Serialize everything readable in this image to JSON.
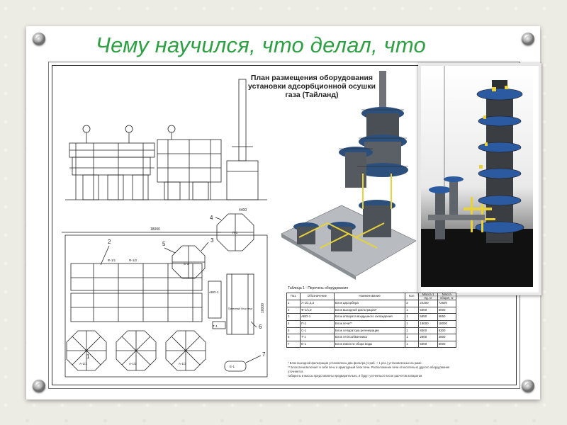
{
  "slide": {
    "title": "Чему научился, что делал, что"
  },
  "drawing": {
    "plan_title": "План размещения оборудования установки адсорбционной осушки газа (Тайланд)",
    "dim_top": "4400",
    "dim_left": "18000",
    "dim_right": "10000",
    "callouts": [
      "1",
      "2",
      "3",
      "4",
      "5",
      "6",
      "7"
    ],
    "equipment_labels": {
      "p1": "П-1",
      "avo": "АВО-1",
      "t1": "Т-1",
      "e1": "Е-1",
      "burner": "Приемный блок печи",
      "a1": "А-1/1",
      "a2": "А-1/2",
      "a3": "А-1/3",
      "f1": "Ф-1/1",
      "f2": "Ф-1/2",
      "c1": "С-1"
    }
  },
  "table": {
    "caption": "Таблица 1 - Перечень оборудования",
    "headers": [
      "Поз.",
      "Обозначение",
      "Наименование",
      "Кол.",
      "Масса 1 ед. кг",
      "Масса общая, кг"
    ],
    "rows": [
      [
        "1",
        "А-1/1,2,3",
        "Блок адсорбера",
        "3",
        "24200",
        "72600"
      ],
      [
        "2",
        "Ф-1/1,2",
        "Блок выходной фильтрации*",
        "1",
        "5000",
        "5000"
      ],
      [
        "3",
        "АВО-1",
        "Блок аппарата воздушного охлаждения",
        "1",
        "5850",
        "5850"
      ],
      [
        "4",
        "П-1",
        "Блок печи**",
        "1",
        "18000",
        "18000"
      ],
      [
        "5",
        "С-1",
        "Блок сепаратора регенерации",
        "1",
        "8300",
        "8300"
      ],
      [
        "6",
        "Т-1",
        "Блок теплообменника",
        "1",
        "2800",
        "2800"
      ],
      [
        "7",
        "Е-1",
        "Блок емкости сбора воды",
        "1",
        "5000",
        "5000"
      ]
    ],
    "notes": [
      "* Блок выходной фильтрации установлены два фильтра (1 раб. + 1 рез.) установленных на раме.",
      "** Блок печи включает в себя печь и арматурный блок печи. Расположение печи относительно другого оборудования уточняется.",
      "Габариты и массы представлены предварительно, и будут уточняться после расчетов аппаратов"
    ]
  },
  "colors": {
    "title_green": "#2ea043",
    "steel_blue": "#2c4f7c",
    "pipe_yellow": "#e7d23a",
    "platform_grey": "#6f7378"
  }
}
